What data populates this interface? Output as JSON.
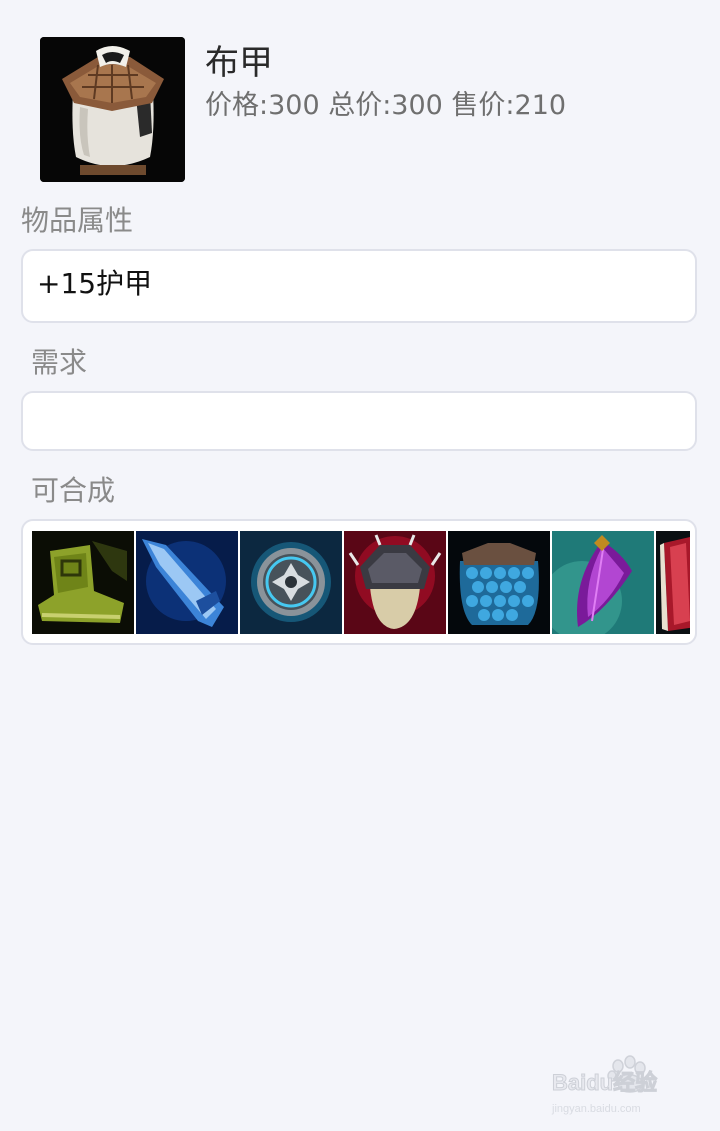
{
  "item": {
    "name": "布甲",
    "price_line": "价格:300 总价:300 售价:210",
    "icon": "cloth-armor-icon"
  },
  "attributes": {
    "label": "物品属性",
    "value": "+15护甲"
  },
  "requirements": {
    "label": "需求",
    "value": ""
  },
  "builds_into": {
    "label": "可合成",
    "items": [
      {
        "icon": "ninja-tabi-boots-icon"
      },
      {
        "icon": "blue-blade-item-icon"
      },
      {
        "icon": "silver-medallion-item-icon"
      },
      {
        "icon": "spiked-shoulder-armor-icon"
      },
      {
        "icon": "scale-mail-bag-icon"
      },
      {
        "icon": "purple-feather-item-icon"
      },
      {
        "icon": "red-book-item-icon"
      }
    ]
  },
  "watermark": {
    "text": "Baidu经验",
    "subtext": "jingyan.baidu.com"
  }
}
